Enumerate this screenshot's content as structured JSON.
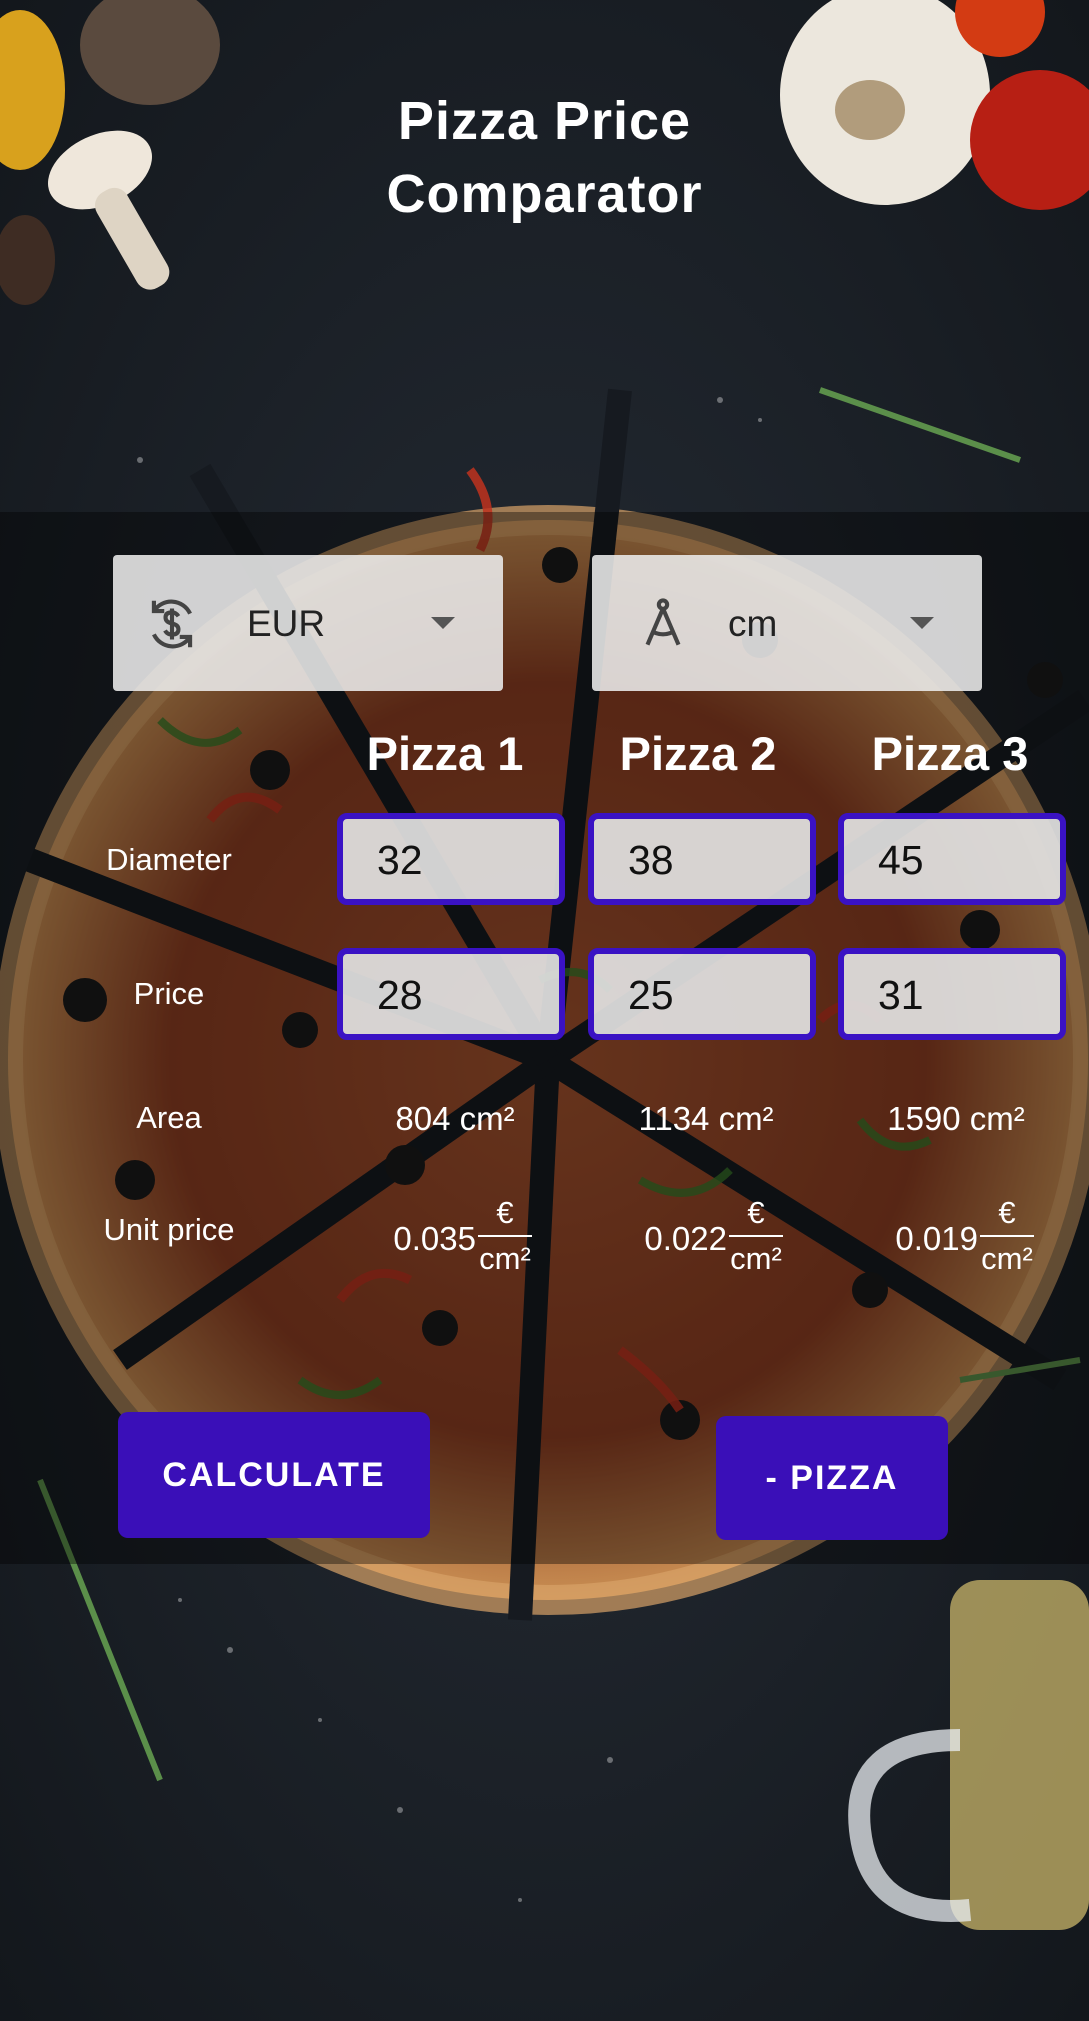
{
  "app": {
    "title_line1": "Pizza Price",
    "title_line2": "Comparator"
  },
  "selectors": {
    "currency": {
      "value": "EUR",
      "icon": "currency-exchange-icon"
    },
    "unit": {
      "value": "cm",
      "icon": "compass-icon"
    }
  },
  "columns": [
    "Pizza 1",
    "Pizza 2",
    "Pizza 3"
  ],
  "rows": {
    "diameter_label": "Diameter",
    "price_label": "Price",
    "area_label": "Area",
    "unit_price_label": "Unit price"
  },
  "pizzas": [
    {
      "diameter": "32",
      "price": "28",
      "area": "804 cm²",
      "unit_price": "0.035",
      "unit_num": "€",
      "unit_den": "cm²"
    },
    {
      "diameter": "38",
      "price": "25",
      "area": "1134 cm²",
      "unit_price": "0.022",
      "unit_num": "€",
      "unit_den": "cm²"
    },
    {
      "diameter": "45",
      "price": "31",
      "area": "1590 cm²",
      "unit_price": "0.019",
      "unit_num": "€",
      "unit_den": "cm²"
    }
  ],
  "buttons": {
    "calculate": "CALCULATE",
    "remove_pizza": "- PIZZA"
  },
  "colors": {
    "accent": "#3a0fb8",
    "field_border": "#3a12c4"
  }
}
